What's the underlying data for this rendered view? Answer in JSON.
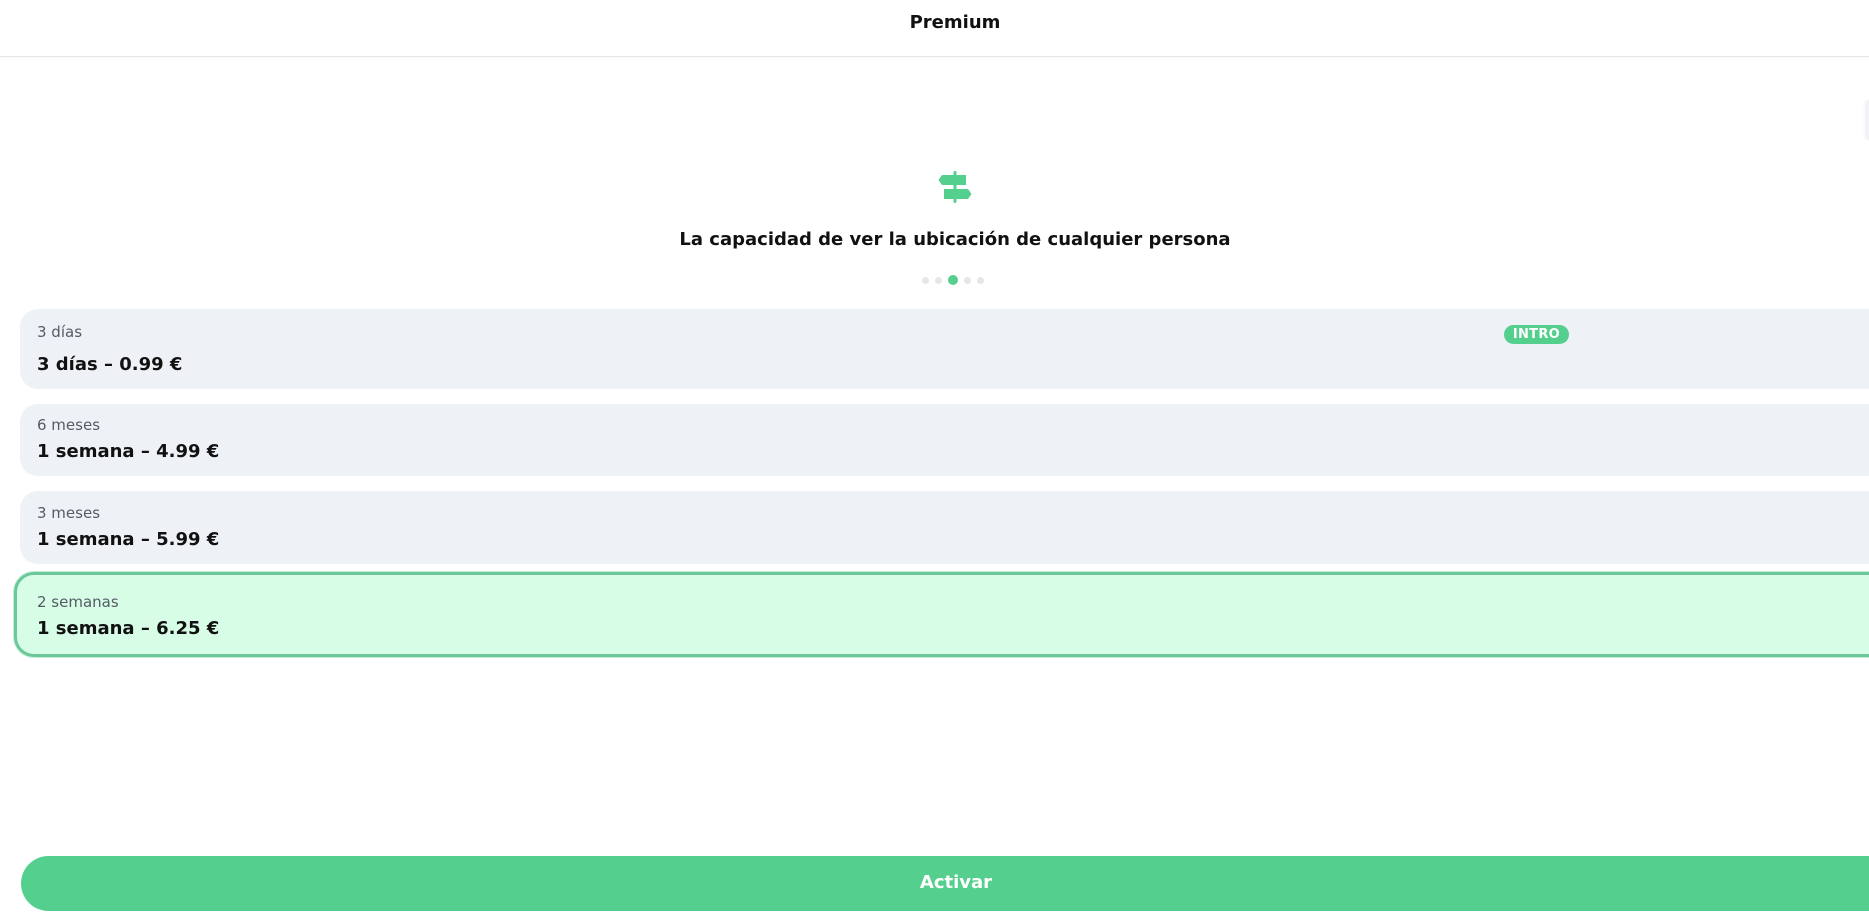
{
  "header": {
    "title": "Premium"
  },
  "feature": {
    "icon": "signpost-icon",
    "text": "La capacidad de ver la ubicación de cualquier persona",
    "carousel_pages": 5,
    "carousel_active_index": 2
  },
  "plans": [
    {
      "label": "3 días",
      "price": "3 días – 0.99 €",
      "badge": "INTRO",
      "selected": false
    },
    {
      "label": "6 meses",
      "price": "1 semana – 4.99 €",
      "selected": false
    },
    {
      "label": "3 meses",
      "price": "1 semana – 5.99 €",
      "selected": false
    },
    {
      "label": "2 semanas",
      "price": "1 semana – 6.25 €",
      "selected": true
    }
  ],
  "actions": {
    "activate_label": "Activar"
  },
  "colors": {
    "accent": "#55cf8e",
    "card_background": "#eef2f7",
    "selected_card_background": "#d8fde7",
    "selected_border": "#6cc89a"
  }
}
